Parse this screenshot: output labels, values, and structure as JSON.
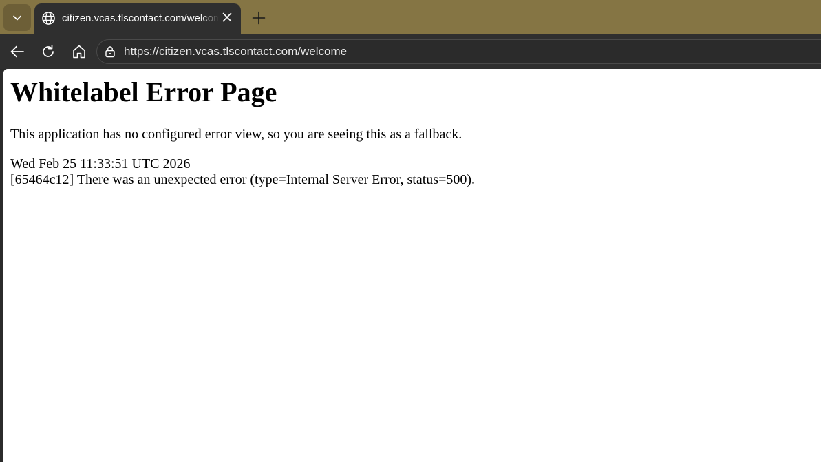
{
  "browser": {
    "tab": {
      "title": "citizen.vcas.tlscontact.com/welcome",
      "favicon": "globe-icon",
      "close_icon": "close-icon"
    },
    "tab_menu_icon": "chevron-down-icon",
    "new_tab_icon": "plus-icon",
    "toolbar": {
      "back_icon": "arrow-left-icon",
      "reload_icon": "reload-icon",
      "home_icon": "home-icon",
      "site_info_icon": "lock-icon",
      "url": "https://citizen.vcas.tlscontact.com/welcome"
    },
    "colors": {
      "tabstrip": "#857544",
      "toolbar": "#2f2f2f",
      "text": "#ffffff"
    }
  },
  "page": {
    "title": "Whitelabel Error Page",
    "description": "This application has no configured error view, so you are seeing this as a fallback.",
    "timestamp": "Wed Feb 25 11:33:51 UTC 2026",
    "error_message": "[65464c12] There was an unexpected error (type=Internal Server Error, status=500)."
  }
}
